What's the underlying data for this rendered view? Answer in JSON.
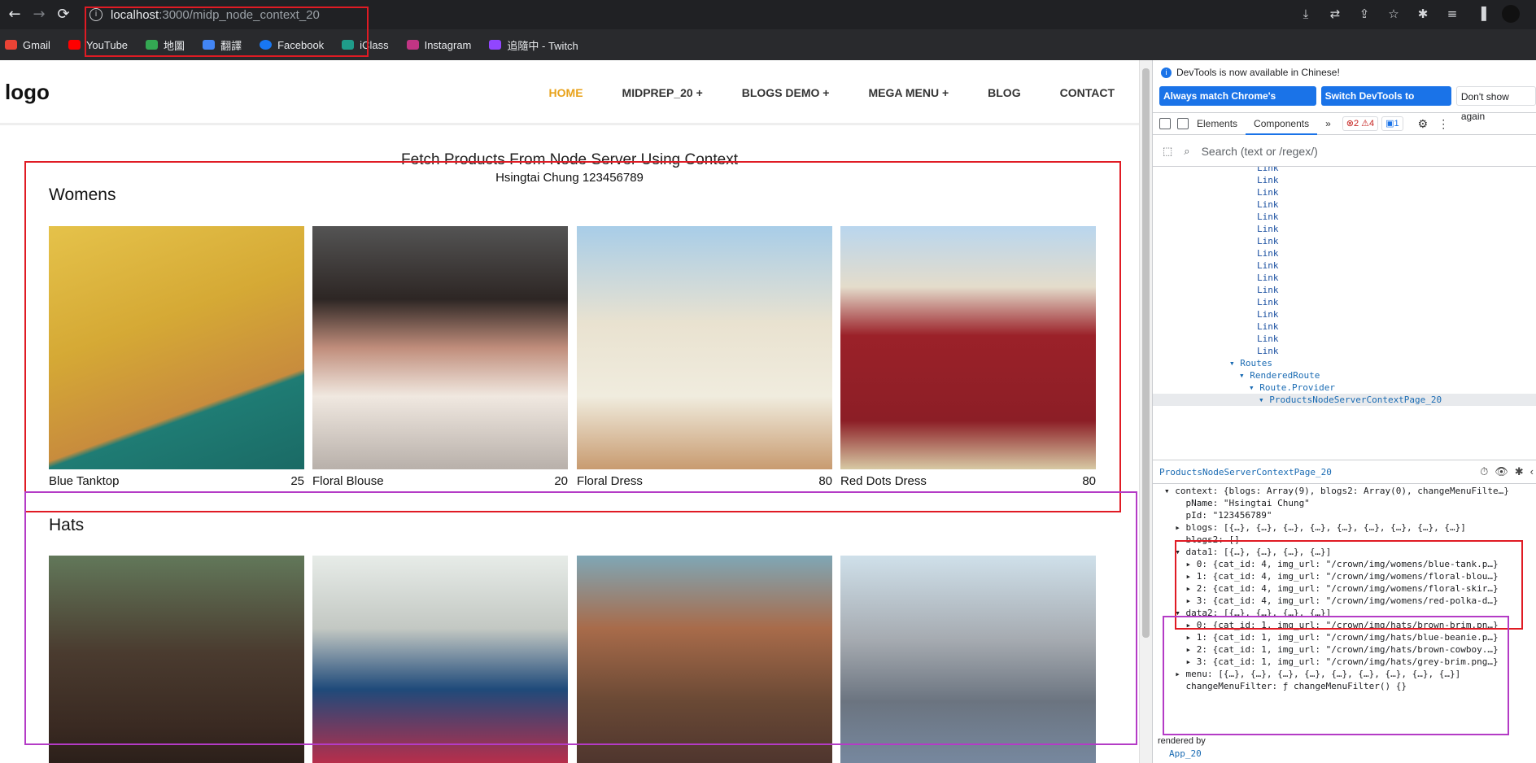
{
  "browser": {
    "nav": {
      "back": "←",
      "forward": "→",
      "reload": "⟳"
    },
    "url_host": "localhost",
    "url_rest": ":3000/midp_node_context_20",
    "right_icons": [
      "⤓",
      "⇄",
      "⇪",
      "☆",
      "✱",
      "≡",
      "▐"
    ]
  },
  "bookmarks": [
    {
      "label": "Gmail",
      "color": "#ea4335"
    },
    {
      "label": "YouTube",
      "color": "#ff0000"
    },
    {
      "label": "地圖",
      "color": "#34a853"
    },
    {
      "label": "翻譯",
      "color": "#4285f4"
    },
    {
      "label": "Facebook",
      "color": "#1877f2"
    },
    {
      "label": "iClass",
      "color": "#1f9c8a"
    },
    {
      "label": "Instagram",
      "color": "#c13584"
    },
    {
      "label": "追隨中 - Twitch",
      "color": "#9146ff"
    }
  ],
  "site": {
    "logo": "logo",
    "menu": [
      "HOME",
      "MIDPREP_20 +",
      "BLOGS DEMO +",
      "MEGA MENU +",
      "BLOG",
      "CONTACT"
    ],
    "page_title": "Fetch Products From Node Server Using Context",
    "page_sub": "Hsingtai Chung 123456789",
    "sections": [
      {
        "title": "Womens",
        "items": [
          {
            "name": "Blue Tanktop",
            "price": "25"
          },
          {
            "name": "Floral Blouse",
            "price": "20"
          },
          {
            "name": "Floral Dress",
            "price": "80"
          },
          {
            "name": "Red Dots Dress",
            "price": "80"
          }
        ]
      },
      {
        "title": "Hats",
        "items": [
          {
            "name": "",
            "price": ""
          },
          {
            "name": "",
            "price": ""
          },
          {
            "name": "",
            "price": ""
          },
          {
            "name": "",
            "price": ""
          }
        ]
      }
    ]
  },
  "devtools": {
    "info": "DevTools is now available in Chinese!",
    "buttons": [
      "Always match Chrome's language",
      "Switch DevTools to Chinese",
      "Don't show again"
    ],
    "tabs": [
      "Elements",
      "Components",
      "»"
    ],
    "badges": [
      "⊗2 ⚠4",
      "▣1"
    ],
    "search_placeholder": "Search (text or /regex/)",
    "tree": {
      "link_label": "Link",
      "link_count": 16,
      "routes": "▾ Routes",
      "rendered_route": "▾ RenderedRoute",
      "route_provider": "▾ Route.Provider",
      "selected": "▾ ProductsNodeServerContextPage_20"
    },
    "selected_component": "ProductsNodeServerContextPage_20",
    "props": [
      "▾ context: {blogs: Array(9), blogs2: Array(0), changeMenuFilte…}",
      "    pName: \"Hsingtai Chung\"",
      "    pId: \"123456789\"",
      "  ▸ blogs: [{…}, {…}, {…}, {…}, {…}, {…}, {…}, {…}, {…}]",
      "    blogs2: []",
      "  ▾ data1: [{…}, {…}, {…}, {…}]",
      "    ▸ 0: {cat_id: 4, img_url: \"/crown/img/womens/blue-tank.p…}",
      "    ▸ 1: {cat_id: 4, img_url: \"/crown/img/womens/floral-blou…}",
      "    ▸ 2: {cat_id: 4, img_url: \"/crown/img/womens/floral-skir…}",
      "    ▸ 3: {cat_id: 4, img_url: \"/crown/img/womens/red-polka-d…}",
      "  ▾ data2: [{…}, {…}, {…}, {…}]",
      "    ▸ 0: {cat_id: 1, img_url: \"/crown/img/hats/brown-brim.pn…}",
      "    ▸ 1: {cat_id: 1, img_url: \"/crown/img/hats/blue-beanie.p…}",
      "    ▸ 2: {cat_id: 1, img_url: \"/crown/img/hats/brown-cowboy.…}",
      "    ▸ 3: {cat_id: 1, img_url: \"/crown/img/hats/grey-brim.png…}",
      "  ▸ menu: [{…}, {…}, {…}, {…}, {…}, {…}, {…}, {…}, {…}]",
      "    changeMenuFilter: ƒ changeMenuFilter() {}"
    ],
    "rendered_by": "rendered by",
    "rendered_by_value": "App_20"
  },
  "annotation_colors": {
    "red": "#e01b24",
    "purple": "#b43bc6"
  }
}
